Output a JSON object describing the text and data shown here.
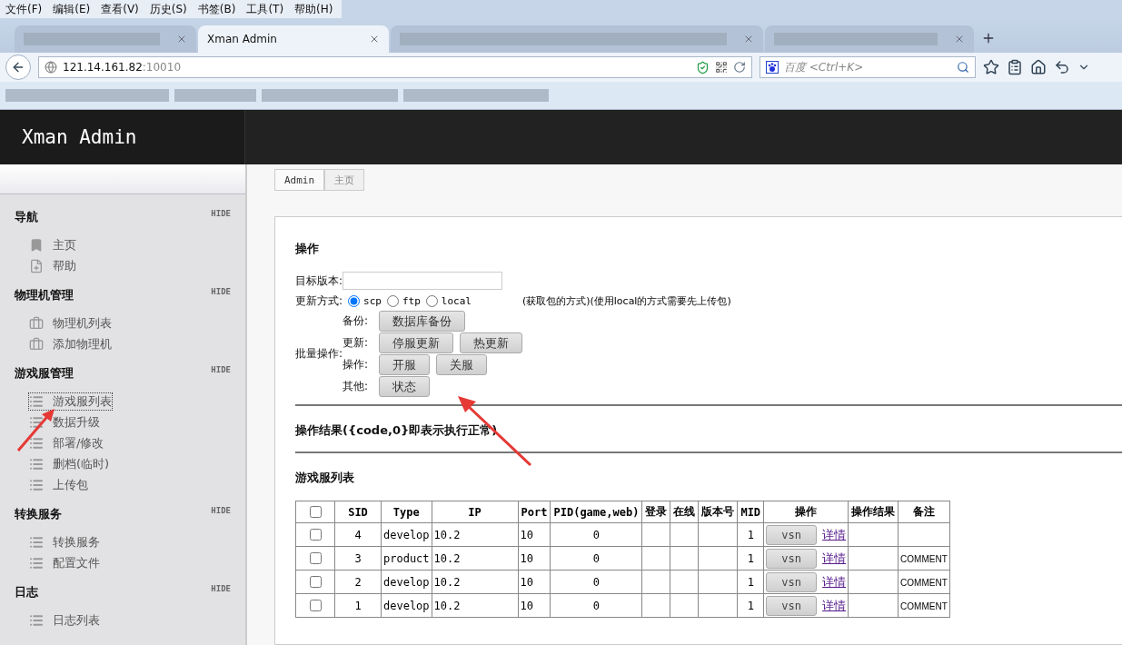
{
  "browser": {
    "menu": [
      "文件(F)",
      "编辑(E)",
      "查看(V)",
      "历史(S)",
      "书签(B)",
      "工具(T)",
      "帮助(H)"
    ],
    "tabs": [
      {
        "selected": false
      },
      {
        "title": "Xman Admin",
        "selected": true
      },
      {
        "selected": false
      },
      {
        "selected": false
      }
    ],
    "address": {
      "host": "121.14.161.82",
      "port": ":10010"
    },
    "search": {
      "placeholder": "百度 <Ctrl+K>"
    }
  },
  "app": {
    "title": "Xman Admin",
    "breadcrumb": [
      {
        "label": "Admin",
        "selected": false
      },
      {
        "label": "主页",
        "selected": true
      }
    ],
    "sidebar": [
      {
        "title": "导航",
        "hide": "HIDE",
        "items": [
          {
            "label": "主页",
            "kind": "bookmark",
            "selected": false
          },
          {
            "label": "帮助",
            "kind": "page",
            "selected": false
          }
        ]
      },
      {
        "title": "物理机管理",
        "hide": "HIDE",
        "items": [
          {
            "label": "物理机列表",
            "kind": "box",
            "selected": false
          },
          {
            "label": "添加物理机",
            "kind": "box",
            "selected": false
          }
        ]
      },
      {
        "title": "游戏服管理",
        "hide": "HIDE",
        "items": [
          {
            "label": "游戏服列表",
            "kind": "list",
            "selected": true
          },
          {
            "label": "数据升级",
            "kind": "list",
            "selected": false
          },
          {
            "label": "部署/修改",
            "kind": "list",
            "selected": false
          },
          {
            "label": "删档(临时)",
            "kind": "list",
            "selected": false
          },
          {
            "label": "上传包",
            "kind": "list",
            "selected": false
          }
        ]
      },
      {
        "title": "转换服务",
        "hide": "HIDE",
        "items": [
          {
            "label": "转换服务",
            "kind": "list",
            "selected": false
          },
          {
            "label": "配置文件",
            "kind": "list",
            "selected": false
          }
        ]
      },
      {
        "title": "日志",
        "hide": "HIDE",
        "items": [
          {
            "label": "日志列表",
            "kind": "list",
            "selected": false
          }
        ]
      }
    ]
  },
  "operations": {
    "title": "操作",
    "target_label": "目标版本:",
    "method_label": "更新方式:",
    "methods": [
      {
        "label": "scp",
        "selected": true
      },
      {
        "label": "ftp",
        "selected": false
      },
      {
        "label": "local",
        "selected": false
      }
    ],
    "method_note": "(获取包的方式)(使用local的方式需要先上传包)",
    "batch_label": "批量操作:",
    "groups": [
      {
        "label": "备份:",
        "buttons": [
          "数据库备份"
        ]
      },
      {
        "label": "更新:",
        "buttons": [
          "停服更新",
          "热更新"
        ]
      },
      {
        "label": "操作:",
        "buttons": [
          "开服",
          "关服"
        ]
      },
      {
        "label": "其他:",
        "buttons": [
          "状态"
        ]
      }
    ]
  },
  "result_title": "操作结果({code,0}即表示执行正常)",
  "list_title": "游戏服列表",
  "table": {
    "columns": [
      "",
      "SID",
      "Type",
      "IP",
      "Port",
      "PID(game,web)",
      "登录",
      "在线",
      "版本号",
      "MID",
      "操作",
      "操作结果",
      "备注"
    ],
    "header_checked": false,
    "rows": [
      {
        "checked": false,
        "sid": "4",
        "type": "develop",
        "ip": "10.2",
        "port": "10",
        "pid": "0",
        "mid": "1",
        "action": "vsn",
        "link": "详情"
      },
      {
        "checked": false,
        "sid": "3",
        "type": "product",
        "ip": "10.2",
        "port": "10",
        "pid": "0",
        "mid": "1",
        "action": "vsn",
        "link": "详情",
        "comment": "COMMENT"
      },
      {
        "checked": false,
        "sid": "2",
        "type": "develop",
        "ip": "10.2",
        "port": "10",
        "pid": "0",
        "mid": "1",
        "action": "vsn",
        "link": "详情",
        "comment": "COMMENT"
      },
      {
        "checked": false,
        "sid": "1",
        "type": "develop",
        "ip": "10.2",
        "port": "10",
        "pid": "0",
        "mid": "1",
        "action": "vsn",
        "link": "详情",
        "comment": "COMMENT"
      }
    ]
  }
}
